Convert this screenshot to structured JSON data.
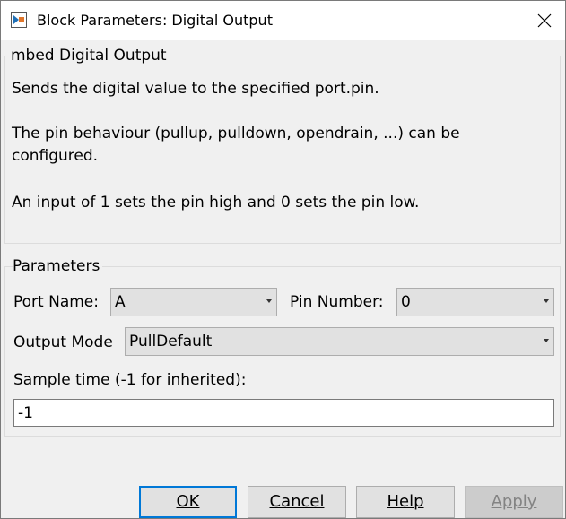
{
  "window": {
    "title": "Block Parameters: Digital Output"
  },
  "description": {
    "legend": "mbed Digital Output",
    "lines": [
      "Sends the digital value to the specified port.pin.",
      "The pin behaviour (pullup, pulldown, opendrain, ...) can be",
      "configured.",
      "An input of 1 sets the pin high and 0 sets the pin low."
    ]
  },
  "parameters": {
    "legend": "Parameters",
    "port_name": {
      "label": "Port Name:",
      "value": "A"
    },
    "pin_number": {
      "label": "Pin Number:",
      "value": "0"
    },
    "output_mode": {
      "label": "Output Mode",
      "value": "PullDefault"
    },
    "sample_time": {
      "label": "Sample time (-1 for inherited):",
      "value": "-1"
    }
  },
  "buttons": {
    "ok": "OK",
    "cancel": "Cancel",
    "help": "Help",
    "apply": "Apply"
  },
  "icons": {
    "app": "simulink-block-icon",
    "close": "close-icon"
  }
}
